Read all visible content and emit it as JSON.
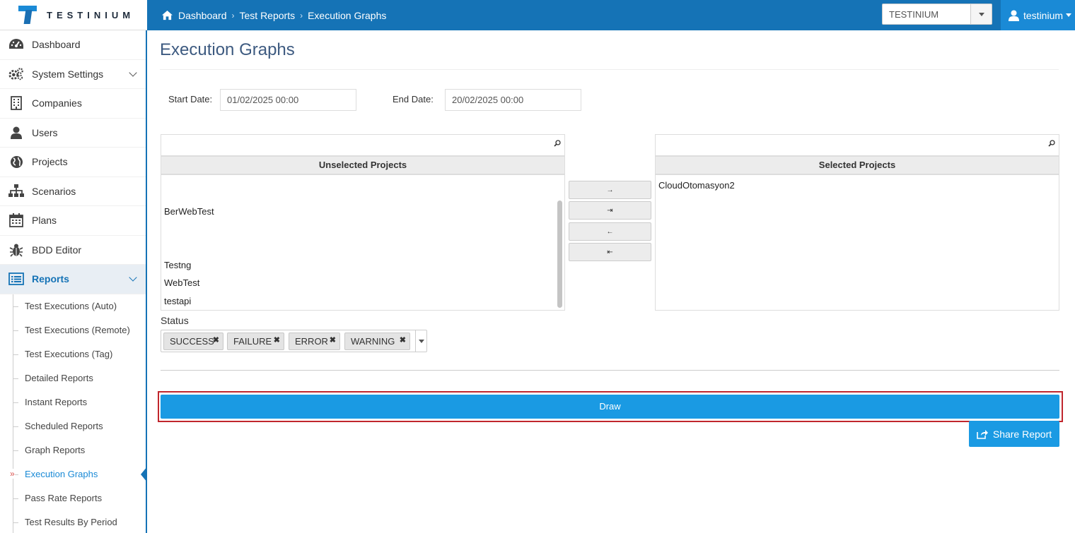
{
  "app": {
    "logo_text": "TESTINIUM"
  },
  "breadcrumb": {
    "items": [
      "Dashboard",
      "Test Reports",
      "Execution Graphs"
    ]
  },
  "org_select": {
    "value": "TESTINIUM"
  },
  "user": {
    "name": "testinium"
  },
  "sidebar": {
    "items": [
      {
        "label": "Dashboard",
        "icon": "dashboard-icon"
      },
      {
        "label": "System Settings",
        "icon": "gears-icon",
        "expandable": true
      },
      {
        "label": "Companies",
        "icon": "building-icon"
      },
      {
        "label": "Users",
        "icon": "user-icon"
      },
      {
        "label": "Projects",
        "icon": "globe-icon"
      },
      {
        "label": "Scenarios",
        "icon": "sitemap-icon"
      },
      {
        "label": "Plans",
        "icon": "calendar-icon"
      },
      {
        "label": "BDD Editor",
        "icon": "bug-icon"
      },
      {
        "label": "Reports",
        "icon": "list-icon",
        "expandable": true,
        "active": true
      }
    ],
    "sub_items": [
      "Test Executions (Auto)",
      "Test Executions (Remote)",
      "Test Executions (Tag)",
      "Detailed Reports",
      "Instant Reports",
      "Scheduled Reports",
      "Graph Reports",
      "Execution Graphs",
      "Pass Rate Reports",
      "Test Results By Period"
    ],
    "current_sub": "Execution Graphs"
  },
  "page": {
    "title": "Execution Graphs"
  },
  "filters": {
    "start_label": "Start Date:",
    "start_value": "01/02/2025 00:00",
    "end_label": "End Date:",
    "end_value": "20/02/2025 00:00"
  },
  "projects": {
    "unselected_header": "Unselected Projects",
    "selected_header": "Selected Projects",
    "unselected": [
      "BerWebTest",
      "Testng",
      "WebTest",
      "testapi"
    ],
    "selected": [
      "CloudOtomasyon2"
    ],
    "move_buttons": [
      "→",
      "⇥",
      "←",
      "⇤"
    ]
  },
  "status": {
    "label": "Status",
    "tags": [
      "SUCCESS",
      "FAILURE",
      "ERROR",
      "WARNING"
    ]
  },
  "actions": {
    "draw_label": "Draw",
    "share_label": "Share Report"
  },
  "colors": {
    "topbar": "#1573b6",
    "primary_button": "#1a9ae3",
    "highlight_frame": "#c0262d",
    "title": "#3d5a80"
  }
}
